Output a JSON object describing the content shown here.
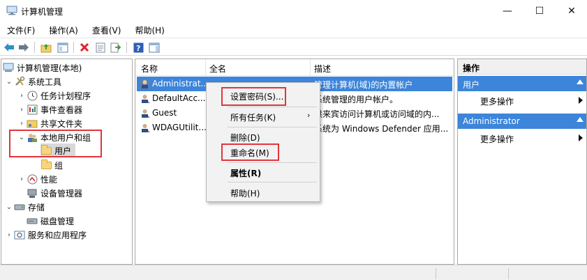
{
  "window": {
    "title": "计算机管理",
    "min_glyph": "—",
    "max_glyph": "☐",
    "close_glyph": "✕"
  },
  "menu": [
    "文件(F)",
    "操作(A)",
    "查看(V)",
    "帮助(H)"
  ],
  "toolbar": {
    "icons": [
      "back-icon",
      "forward-icon",
      "up-folder-icon",
      "show-hide-tree-icon",
      "delete-icon",
      "properties-icon",
      "export-list-icon",
      "help-icon",
      "show-action-pane-icon"
    ]
  },
  "tree": {
    "root": "计算机管理(本地)",
    "system_tools": "系统工具",
    "task_scheduler": "任务计划程序",
    "event_viewer": "事件查看器",
    "shared_folders": "共享文件夹",
    "local_users_groups": "本地用户和组",
    "users": "用户",
    "groups": "组",
    "performance": "性能",
    "device_manager": "设备管理器",
    "storage": "存储",
    "disk_management": "磁盘管理",
    "services_apps": "服务和应用程序"
  },
  "list": {
    "columns": [
      "名称",
      "全名",
      "描述"
    ],
    "rows": [
      {
        "name": "Administrat...",
        "full": "",
        "desc": "管理计算机(域)的内置帐户"
      },
      {
        "name": "DefaultAcc...",
        "full": "",
        "desc": "系统管理的用户帐户。"
      },
      {
        "name": "Guest",
        "full": "",
        "desc": "供来宾访问计算机或访问域的内..."
      },
      {
        "name": "WDAGUtilit...",
        "full": "",
        "desc": "系统为 Windows Defender 应用..."
      }
    ]
  },
  "context_menu": {
    "set_password": "设置密码(S)...",
    "all_tasks": "所有任务(K)",
    "delete": "删除(D)",
    "rename": "重命名(M)",
    "properties": "属性(R)",
    "help": "帮助(H)"
  },
  "actions": {
    "header": "操作",
    "section1": "用户",
    "more1": "更多操作",
    "section2": "Administrator",
    "more2": "更多操作"
  },
  "colors": {
    "selection": "#3c85da",
    "highlight_box": "#e0353b"
  }
}
